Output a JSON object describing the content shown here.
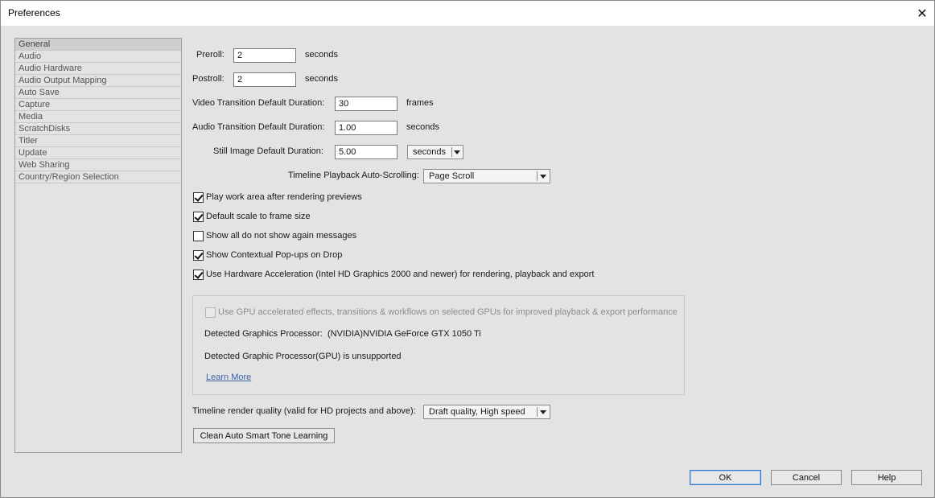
{
  "window": {
    "title": "Preferences"
  },
  "sidebar": {
    "items": [
      {
        "label": "General"
      },
      {
        "label": "Audio"
      },
      {
        "label": "Audio Hardware"
      },
      {
        "label": "Audio Output Mapping"
      },
      {
        "label": "Auto Save"
      },
      {
        "label": "Capture"
      },
      {
        "label": "Media"
      },
      {
        "label": "ScratchDisks"
      },
      {
        "label": "Titler"
      },
      {
        "label": "Update"
      },
      {
        "label": "Web Sharing"
      },
      {
        "label": "Country/Region Selection"
      }
    ]
  },
  "general": {
    "preroll": {
      "label": "Preroll:",
      "value": "2",
      "unit": "seconds"
    },
    "postroll": {
      "label": "Postroll:",
      "value": "2",
      "unit": "seconds"
    },
    "video_transition": {
      "label": "Video Transition Default Duration:",
      "value": "30",
      "unit": "frames"
    },
    "audio_transition": {
      "label": "Audio Transition Default Duration:",
      "value": "1.00",
      "unit": "seconds"
    },
    "still_image": {
      "label": "Still Image Default Duration:",
      "value": "5.00",
      "unit_selected": "seconds"
    },
    "autoscroll": {
      "label": "Timeline Playback Auto-Scrolling:",
      "selected": "Page Scroll"
    },
    "checkboxes": [
      {
        "label": "Play work area after rendering previews",
        "checked": true
      },
      {
        "label": "Default scale to frame size",
        "checked": true
      },
      {
        "label": "Show all do not show again messages",
        "checked": false
      },
      {
        "label": "Show Contextual Pop-ups on Drop",
        "checked": true
      },
      {
        "label": "Use Hardware Acceleration (Intel HD Graphics 2000 and newer) for rendering, playback and export",
        "checked": true
      }
    ],
    "gpu": {
      "checkbox_label": "Use GPU accelerated effects, transitions & workflows on selected GPUs for improved playback & export performance",
      "detected_label": "Detected Graphics Processor:",
      "detected_value": "(NVIDIA)NVIDIA GeForce GTX 1050 Ti",
      "unsupported_text": "Detected Graphic Processor(GPU) is unsupported",
      "learn_more": "Learn More"
    },
    "render_quality": {
      "label": "Timeline render quality (valid for HD projects and above):",
      "selected": "Draft quality, High speed"
    },
    "clean_button": "Clean Auto Smart Tone Learning"
  },
  "footer": {
    "ok": "OK",
    "cancel": "Cancel",
    "help": "Help"
  }
}
